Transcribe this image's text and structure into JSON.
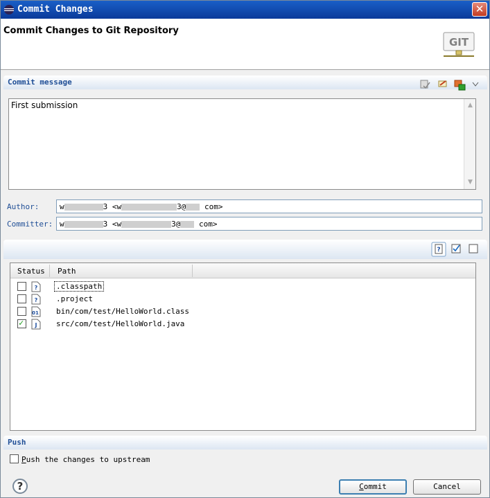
{
  "window": {
    "title": "Commit Changes",
    "close_label": "✕"
  },
  "banner": {
    "heading": "Commit Changes to Git Repository",
    "logo_text": "GIT"
  },
  "commit_message": {
    "section_title": "Commit message",
    "text": "First submission"
  },
  "author": {
    "label": "Author:",
    "value_start": "w",
    "value_mid": "3 <w",
    "value_end": "com>"
  },
  "committer": {
    "label": "Committer:",
    "value_start": "w",
    "value_mid": "3 <w",
    "value_end": "com>"
  },
  "files": {
    "columns": [
      "Status",
      "Path"
    ],
    "rows": [
      {
        "path": ".classpath",
        "checked": false
      },
      {
        "path": ".project",
        "checked": false
      },
      {
        "path": "bin/com/test/HelloWorld.class",
        "checked": false
      },
      {
        "path": "src/com/test/HelloWorld.java",
        "checked": true
      }
    ]
  },
  "push": {
    "section_title": "Push",
    "checkbox_label_first": "P",
    "checkbox_label_rest": "ush the changes to upstream"
  },
  "buttons": {
    "commit_first": "C",
    "commit_rest": "ommit",
    "cancel": "Cancel"
  },
  "colors": {
    "accent": "#1f4e96",
    "title_bar": "#0a3a9a"
  }
}
